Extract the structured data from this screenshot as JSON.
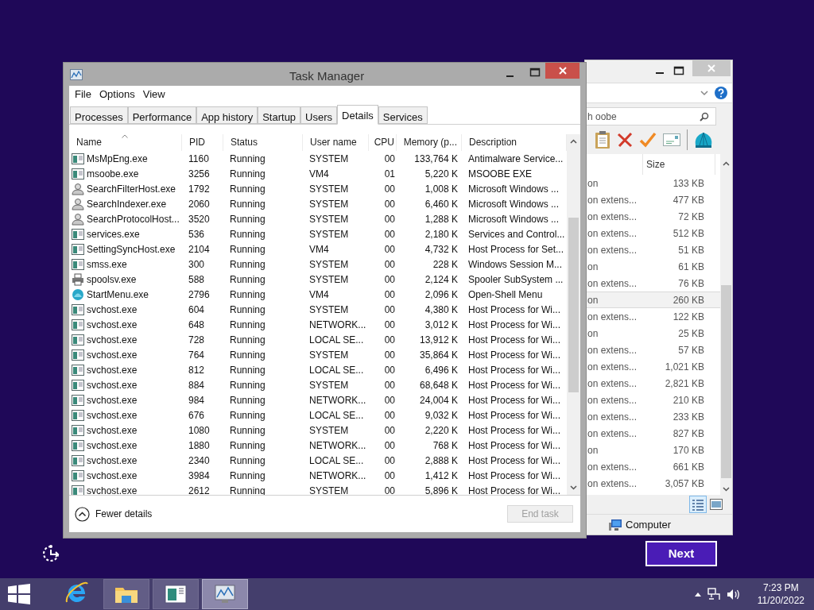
{
  "task_manager": {
    "title": "Task Manager",
    "menu": [
      "File",
      "Options",
      "View"
    ],
    "tabs": [
      {
        "label": "Processes",
        "selected": false
      },
      {
        "label": "Performance",
        "selected": false
      },
      {
        "label": "App history",
        "selected": false
      },
      {
        "label": "Startup",
        "selected": false
      },
      {
        "label": "Users",
        "selected": false
      },
      {
        "label": "Details",
        "selected": true
      },
      {
        "label": "Services",
        "selected": false
      }
    ],
    "columns": [
      "Name",
      "PID",
      "Status",
      "User name",
      "CPU",
      "Memory (p...",
      "Description"
    ],
    "rows": [
      {
        "kind": "window",
        "cells": [
          "MsMpEng.exe",
          "1160",
          "Running",
          "SYSTEM",
          "00",
          "133,764 K",
          "Antimalware Service..."
        ]
      },
      {
        "kind": "window",
        "cells": [
          "msoobe.exe",
          "3256",
          "Running",
          "VM4",
          "01",
          "5,220 K",
          "MSOOBE EXE"
        ]
      },
      {
        "kind": "user",
        "cells": [
          "SearchFilterHost.exe",
          "1792",
          "Running",
          "SYSTEM",
          "00",
          "1,008 K",
          "Microsoft Windows ..."
        ]
      },
      {
        "kind": "user",
        "cells": [
          "SearchIndexer.exe",
          "2060",
          "Running",
          "SYSTEM",
          "00",
          "6,460 K",
          "Microsoft Windows ..."
        ]
      },
      {
        "kind": "user",
        "cells": [
          "SearchProtocolHost...",
          "3520",
          "Running",
          "SYSTEM",
          "00",
          "1,288 K",
          "Microsoft Windows ..."
        ]
      },
      {
        "kind": "window",
        "cells": [
          "services.exe",
          "536",
          "Running",
          "SYSTEM",
          "00",
          "2,180 K",
          "Services and Control..."
        ]
      },
      {
        "kind": "window",
        "cells": [
          "SettingSyncHost.exe",
          "2104",
          "Running",
          "VM4",
          "00",
          "4,732 K",
          "Host Process for Set..."
        ]
      },
      {
        "kind": "window",
        "cells": [
          "smss.exe",
          "300",
          "Running",
          "SYSTEM",
          "00",
          "228 K",
          "Windows Session M..."
        ]
      },
      {
        "kind": "printer",
        "cells": [
          "spoolsv.exe",
          "588",
          "Running",
          "SYSTEM",
          "00",
          "2,124 K",
          "Spooler SubSystem ..."
        ]
      },
      {
        "kind": "shell",
        "cells": [
          "StartMenu.exe",
          "2796",
          "Running",
          "VM4",
          "00",
          "2,096 K",
          "Open-Shell Menu"
        ]
      },
      {
        "kind": "window",
        "cells": [
          "svchost.exe",
          "604",
          "Running",
          "SYSTEM",
          "00",
          "4,380 K",
          "Host Process for Wi..."
        ]
      },
      {
        "kind": "window",
        "cells": [
          "svchost.exe",
          "648",
          "Running",
          "NETWORK...",
          "00",
          "3,012 K",
          "Host Process for Wi..."
        ]
      },
      {
        "kind": "window",
        "cells": [
          "svchost.exe",
          "728",
          "Running",
          "LOCAL SE...",
          "00",
          "13,912 K",
          "Host Process for Wi..."
        ]
      },
      {
        "kind": "window",
        "cells": [
          "svchost.exe",
          "764",
          "Running",
          "SYSTEM",
          "00",
          "35,864 K",
          "Host Process for Wi..."
        ]
      },
      {
        "kind": "window",
        "cells": [
          "svchost.exe",
          "812",
          "Running",
          "LOCAL SE...",
          "00",
          "6,496 K",
          "Host Process for Wi..."
        ]
      },
      {
        "kind": "window",
        "cells": [
          "svchost.exe",
          "884",
          "Running",
          "SYSTEM",
          "00",
          "68,648 K",
          "Host Process for Wi..."
        ]
      },
      {
        "kind": "window",
        "cells": [
          "svchost.exe",
          "984",
          "Running",
          "NETWORK...",
          "00",
          "24,004 K",
          "Host Process for Wi..."
        ]
      },
      {
        "kind": "window",
        "cells": [
          "svchost.exe",
          "676",
          "Running",
          "LOCAL SE...",
          "00",
          "9,032 K",
          "Host Process for Wi..."
        ]
      },
      {
        "kind": "window",
        "cells": [
          "svchost.exe",
          "1080",
          "Running",
          "SYSTEM",
          "00",
          "2,220 K",
          "Host Process for Wi..."
        ]
      },
      {
        "kind": "window",
        "cells": [
          "svchost.exe",
          "1880",
          "Running",
          "NETWORK...",
          "00",
          "768 K",
          "Host Process for Wi..."
        ]
      },
      {
        "kind": "window",
        "cells": [
          "svchost.exe",
          "2340",
          "Running",
          "LOCAL SE...",
          "00",
          "2,888 K",
          "Host Process for Wi..."
        ]
      },
      {
        "kind": "window",
        "cells": [
          "svchost.exe",
          "3984",
          "Running",
          "NETWORK...",
          "00",
          "1,412 K",
          "Host Process for Wi..."
        ]
      },
      {
        "kind": "window",
        "cells": [
          "svchost.exe",
          "2612",
          "Running",
          "SYSTEM",
          "00",
          "5,896 K",
          "Host Process for Wi..."
        ]
      }
    ],
    "fewer_details": "Fewer details",
    "end_task": {
      "label": "End task",
      "disabled": true
    }
  },
  "explorer": {
    "search": {
      "value": "h oobe"
    },
    "size_header": "Size",
    "rows": [
      {
        "type": "on",
        "size": "133 KB",
        "selected": false
      },
      {
        "type": "on extens...",
        "size": "477 KB",
        "selected": false
      },
      {
        "type": "on extens...",
        "size": "72 KB",
        "selected": false
      },
      {
        "type": "on extens...",
        "size": "512 KB",
        "selected": false
      },
      {
        "type": "on extens...",
        "size": "51 KB",
        "selected": false
      },
      {
        "type": "on",
        "size": "61 KB",
        "selected": false
      },
      {
        "type": "on extens...",
        "size": "76 KB",
        "selected": false
      },
      {
        "type": "on",
        "size": "260 KB",
        "selected": true
      },
      {
        "type": "on extens...",
        "size": "122 KB",
        "selected": false
      },
      {
        "type": "on",
        "size": "25 KB",
        "selected": false
      },
      {
        "type": "on extens...",
        "size": "57 KB",
        "selected": false
      },
      {
        "type": "on extens...",
        "size": "1,021 KB",
        "selected": false
      },
      {
        "type": "on extens...",
        "size": "2,821 KB",
        "selected": false
      },
      {
        "type": "on extens...",
        "size": "210 KB",
        "selected": false
      },
      {
        "type": "on extens...",
        "size": "233 KB",
        "selected": false
      },
      {
        "type": "on extens...",
        "size": "827 KB",
        "selected": false
      },
      {
        "type": "on",
        "size": "170 KB",
        "selected": false
      },
      {
        "type": "on extens...",
        "size": "661 KB",
        "selected": false
      },
      {
        "type": "on extens...",
        "size": "3,057 KB",
        "selected": false
      }
    ],
    "status_item": "Computer"
  },
  "next_button": "Next",
  "taskbar": {
    "apps": [
      {
        "kind": "browser",
        "running": false,
        "selected": false
      },
      {
        "kind": "folder",
        "running": true,
        "selected": false
      },
      {
        "kind": "app",
        "running": true,
        "selected": false
      },
      {
        "kind": "monitor",
        "running": true,
        "selected": true
      }
    ],
    "time": "7:23 PM",
    "date": "11/20/2022"
  }
}
